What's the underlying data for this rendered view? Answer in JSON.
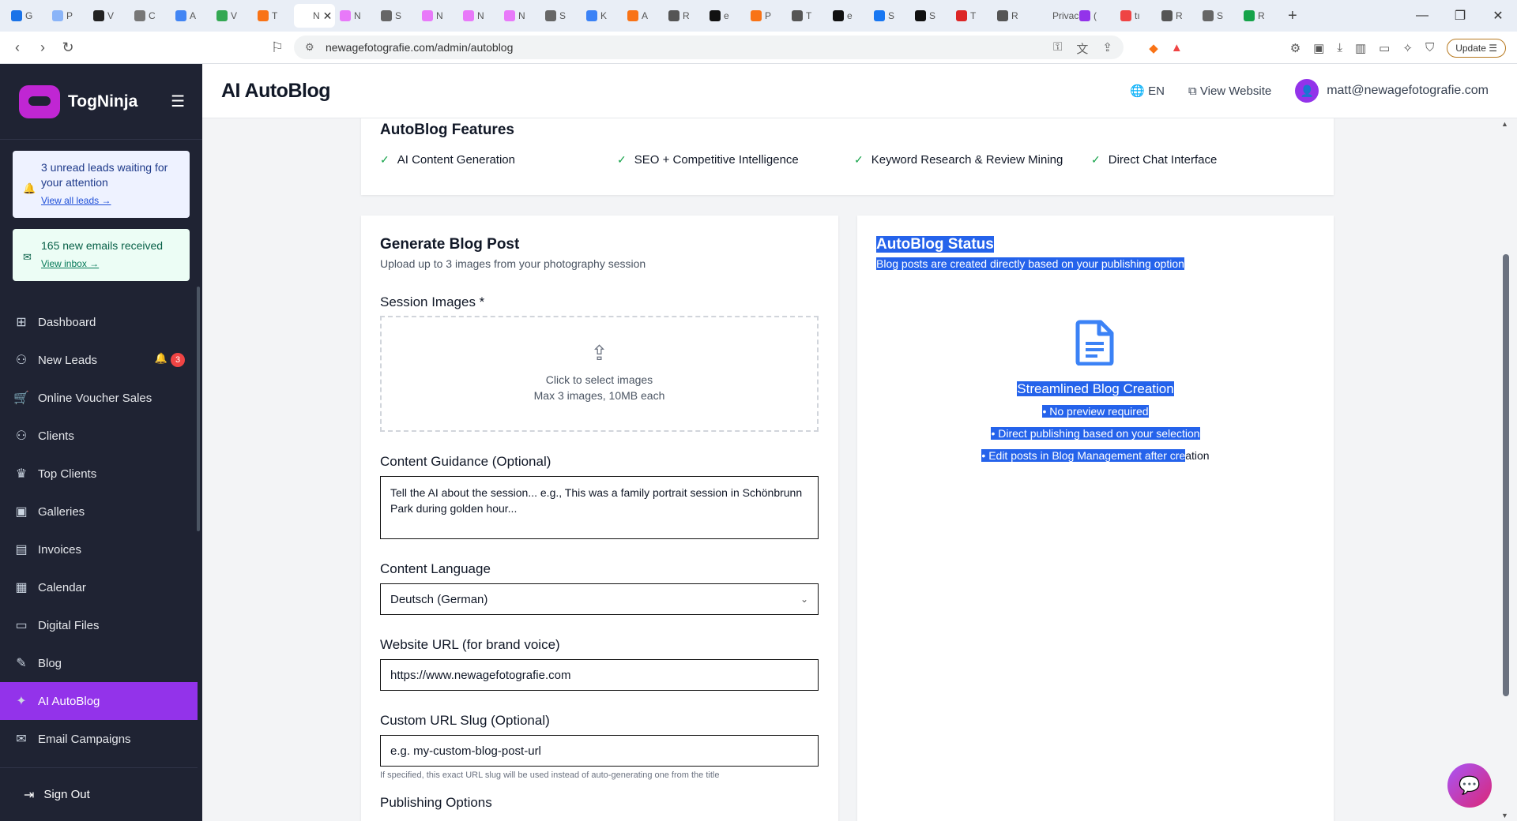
{
  "browser": {
    "tabs": [
      {
        "label": "G",
        "color": "#1a73e8"
      },
      {
        "label": "P",
        "color": "#8ab4f8"
      },
      {
        "label": "V",
        "color": "#222"
      },
      {
        "label": "C",
        "color": "#777"
      },
      {
        "label": "A",
        "color": "#4285f4"
      },
      {
        "label": "V",
        "color": "#34a853"
      },
      {
        "label": "T",
        "color": "#f97316"
      },
      {
        "label": "N",
        "color": "#fff",
        "active": true
      },
      {
        "label": "N",
        "color": "#e879f9"
      },
      {
        "label": "S",
        "color": "#666"
      },
      {
        "label": "N",
        "color": "#e879f9"
      },
      {
        "label": "N",
        "color": "#e879f9"
      },
      {
        "label": "N",
        "color": "#e879f9"
      },
      {
        "label": "S",
        "color": "#666"
      },
      {
        "label": "K",
        "color": "#3b82f6"
      },
      {
        "label": "A",
        "color": "#f97316"
      },
      {
        "label": "R",
        "color": "#555"
      },
      {
        "label": "e",
        "color": "#111"
      },
      {
        "label": "P",
        "color": "#f97316"
      },
      {
        "label": "T",
        "color": "#555"
      },
      {
        "label": "e",
        "color": "#111"
      },
      {
        "label": "S",
        "color": "#1877f2"
      },
      {
        "label": "S",
        "color": "#111"
      },
      {
        "label": "T",
        "color": "#dc2626"
      },
      {
        "label": "R",
        "color": "#555"
      },
      {
        "label": "Privac",
        "color": "#e9eef6"
      },
      {
        "label": "(",
        "color": "#9333ea"
      },
      {
        "label": "tı",
        "color": "#ef4444"
      },
      {
        "label": "R",
        "color": "#555"
      },
      {
        "label": "S",
        "color": "#666"
      },
      {
        "label": "R",
        "color": "#16a34a"
      }
    ],
    "url": "newagefotografie.com/admin/autoblog",
    "update_label": "Update"
  },
  "sidebar": {
    "brand": "TogNinja",
    "leads_notice": {
      "text": "3 unread leads waiting for your attention",
      "link": "View all leads →"
    },
    "email_notice": {
      "text": "165 new emails received",
      "link": "View inbox →"
    },
    "items": [
      {
        "label": "Dashboard",
        "icon": "⊞",
        "name": "dashboard"
      },
      {
        "label": "New Leads",
        "icon": "⚇",
        "name": "new-leads",
        "badge": "3"
      },
      {
        "label": "Online Voucher Sales",
        "icon": "🛒",
        "name": "online-voucher-sales"
      },
      {
        "label": "Clients",
        "icon": "⚇",
        "name": "clients"
      },
      {
        "label": "Top Clients",
        "icon": "♛",
        "name": "top-clients"
      },
      {
        "label": "Galleries",
        "icon": "▣",
        "name": "galleries"
      },
      {
        "label": "Invoices",
        "icon": "▤",
        "name": "invoices"
      },
      {
        "label": "Calendar",
        "icon": "▦",
        "name": "calendar"
      },
      {
        "label": "Digital Files",
        "icon": "▭",
        "name": "digital-files"
      },
      {
        "label": "Blog",
        "icon": "✎",
        "name": "blog"
      },
      {
        "label": "AI AutoBlog",
        "icon": "✦",
        "name": "ai-autoblog",
        "active": true
      },
      {
        "label": "Email Campaigns",
        "icon": "✉",
        "name": "email-campaigns"
      }
    ],
    "sign_out": "Sign Out"
  },
  "header": {
    "title": "AI AutoBlog",
    "lang": "EN",
    "view_website": "View Website",
    "user": "matt@newagefotografie.com"
  },
  "features": {
    "title": "AutoBlog Features",
    "items": [
      "AI Content Generation",
      "SEO + Competitive Intelligence",
      "Keyword Research & Review Mining",
      "Direct Chat Interface"
    ]
  },
  "generate": {
    "title": "Generate Blog Post",
    "subtitle": "Upload up to 3 images from your photography session",
    "images_label": "Session Images *",
    "drop_line1": "Click to select images",
    "drop_line2": "Max 3 images, 10MB each",
    "guidance_label": "Content Guidance (Optional)",
    "guidance_placeholder": "Tell the AI about the session... e.g., This was a family portrait session in Schönbrunn Park during golden hour...",
    "language_label": "Content Language",
    "language_value": "Deutsch (German)",
    "website_label": "Website URL (for brand voice)",
    "website_value": "https://www.newagefotografie.com",
    "slug_label": "Custom URL Slug (Optional)",
    "slug_placeholder": "e.g. my-custom-blog-post-url",
    "slug_hint": "If specified, this exact URL slug will be used instead of auto-generating one from the title",
    "publishing_label": "Publishing Options"
  },
  "status": {
    "title": "AutoBlog Status",
    "subtitle": "Blog posts are created directly based on your publishing option",
    "heading": "Streamlined Blog Creation",
    "line1": "• No preview required",
    "line2": "• Direct publishing based on your selection",
    "line3a": "• Edit posts in Blog Management after cre",
    "line3b": "ation"
  },
  "colors": {
    "accent": "#9333ea",
    "sidebar_bg": "#1f2333",
    "selection": "#2563eb",
    "check": "#16a34a"
  }
}
